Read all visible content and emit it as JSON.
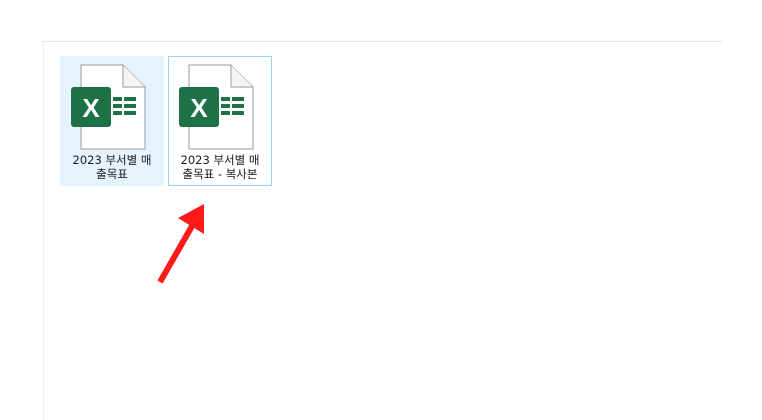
{
  "files": [
    {
      "name_line1": "2023 부서별 매",
      "name_line2": "출목표",
      "icon": "excel-file-icon",
      "state": "hover"
    },
    {
      "name_line1": "2023 부서별 매",
      "name_line2": "출목표 - 복사본",
      "icon": "excel-file-icon",
      "state": "selected"
    }
  ],
  "colors": {
    "excel_green": "#1e7145",
    "hover_bg": "#e5f3ff",
    "selected_border": "#99d1ff",
    "arrow": "#ff1a1a"
  }
}
